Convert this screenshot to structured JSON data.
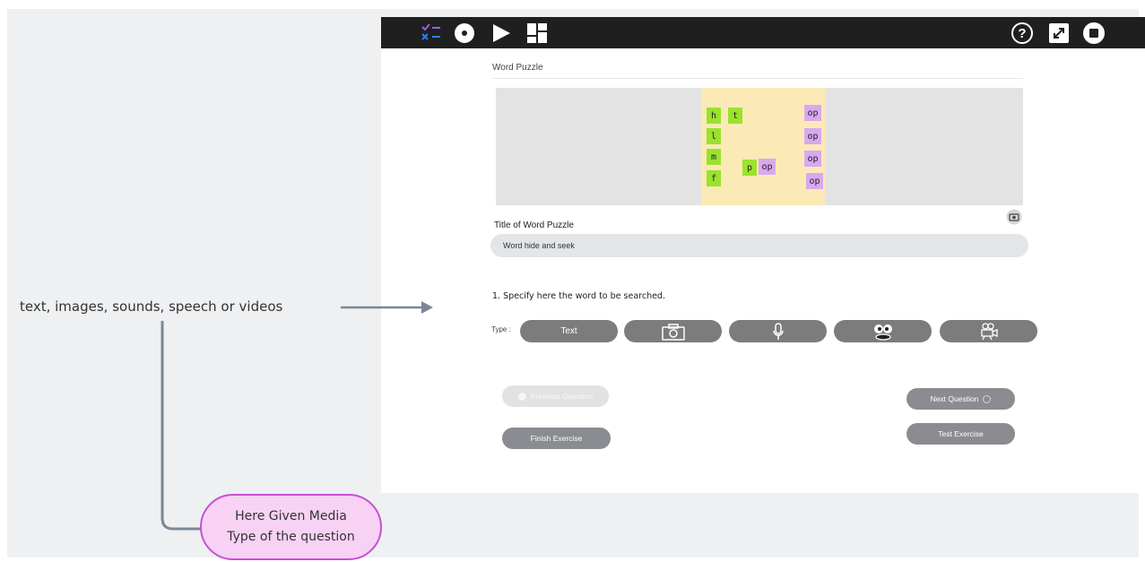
{
  "toolbar": {
    "left_icons": [
      "checklist-icon",
      "record-icon",
      "play-icon",
      "layout-icon"
    ],
    "right_icons": [
      "help-icon",
      "fullscreen-icon",
      "stop-icon"
    ]
  },
  "editor": {
    "heading": "Word Puzzle",
    "puzzle_grid": {
      "letters": [
        "h",
        "t",
        "op",
        "l",
        "op",
        "m",
        "op",
        "p",
        "op",
        "f",
        "op"
      ],
      "colors": {
        "letter_cell": "#9be22e",
        "syllable_cell": "#d9a8ef",
        "grid_background": "#fbeab5"
      }
    },
    "title_label": "Title of Word Puzzle",
    "title_value": "Word hide and seek",
    "question": "1.  Specify here the word to be searched.",
    "type_label": "Type :",
    "type_buttons": [
      {
        "label": "Text",
        "icon": ""
      },
      {
        "label": "",
        "icon": "camera-icon"
      },
      {
        "label": "",
        "icon": "microphone-icon"
      },
      {
        "label": "",
        "icon": "speech-face-icon"
      },
      {
        "label": "",
        "icon": "video-camera-icon"
      }
    ],
    "prev_label": "Previous Question",
    "next_label": "Next Question",
    "finish_label": "Finish Exercise",
    "test_label": "Test Exercise"
  },
  "annotations": {
    "media_types": "text, images, sounds, speech or videos",
    "bubble_line1": "Here Given Media",
    "bubble_line2": "Type of the question",
    "colors": {
      "bubble_fill": "#f7d2f5",
      "bubble_border": "#c94fd4",
      "connector": "#7a8896"
    }
  }
}
